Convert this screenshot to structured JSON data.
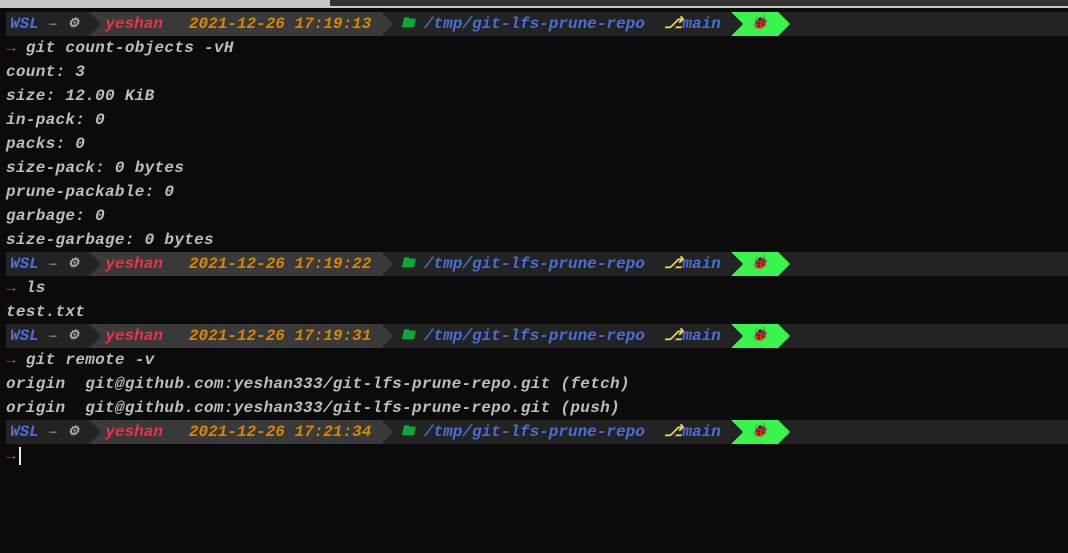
{
  "prompt": {
    "wsl": "WSL",
    "dash": "–",
    "debian_icon": "⚙",
    "user": "yeshan",
    "folder_icon": "🖿",
    "path": "/tmp/git-lfs-prune-repo",
    "branch_icon": "⎇",
    "branch": "main",
    "bug_icon": "🐞"
  },
  "timestamps": {
    "t1": "2021-12-26 17:19:13",
    "t2": "2021-12-26 17:19:22",
    "t3": "2021-12-26 17:19:31",
    "t4": "2021-12-26 17:21:34"
  },
  "arrow": "→",
  "cmds": {
    "c1": "git count-objects -vH",
    "c2": "ls",
    "c3": "git remote -v"
  },
  "out1": {
    "l1": "count: 3",
    "l2": "size: 12.00 KiB",
    "l3": "in-pack: 0",
    "l4": "packs: 0",
    "l5": "size-pack: 0 bytes",
    "l6": "prune-packable: 0",
    "l7": "garbage: 0",
    "l8": "size-garbage: 0 bytes"
  },
  "out2": {
    "l1": "test.txt"
  },
  "out3": {
    "l1": "origin  git@github.com:yeshan333/git-lfs-prune-repo.git (fetch)",
    "l2": "origin  git@github.com:yeshan333/git-lfs-prune-repo.git (push)"
  }
}
